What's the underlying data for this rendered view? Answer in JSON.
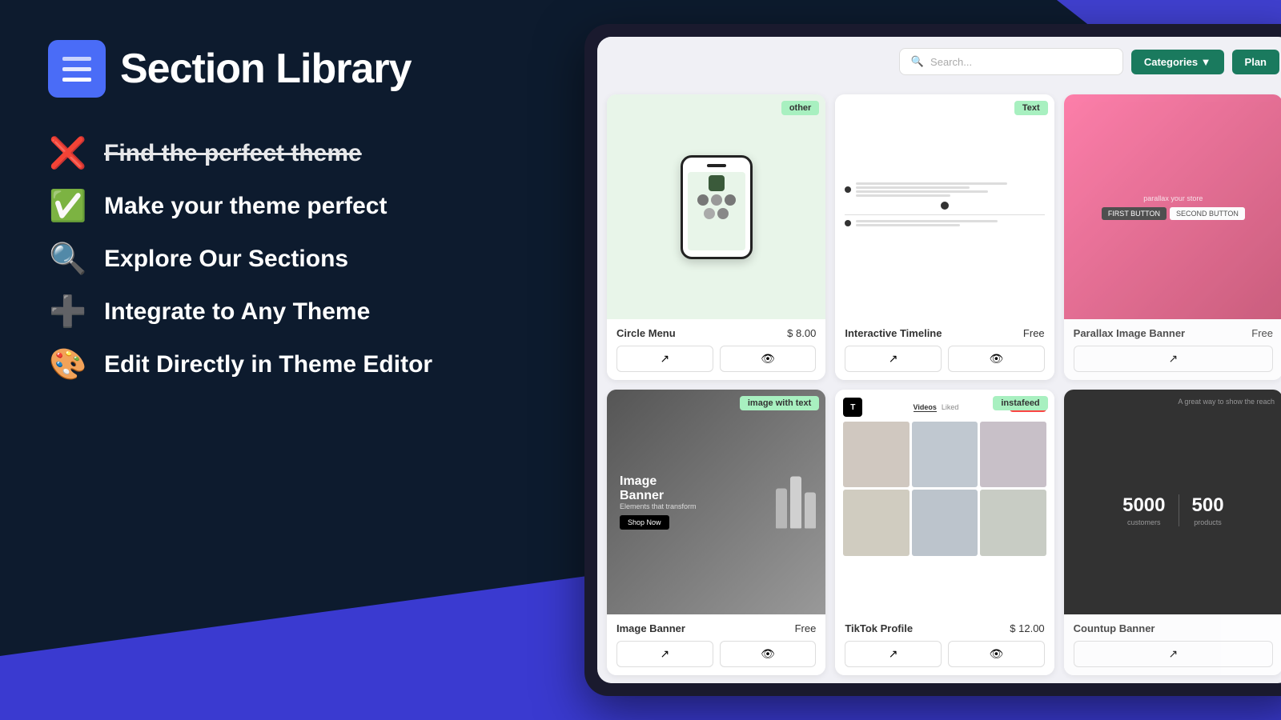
{
  "app": {
    "title": "Section Library"
  },
  "left": {
    "logo_text": "Section Library",
    "features": [
      {
        "icon": "❌",
        "text": "Find the perfect theme",
        "strikethrough": true
      },
      {
        "icon": "✅",
        "text": "Make your theme perfect",
        "strikethrough": false
      },
      {
        "icon": "🔍",
        "text": "Explore Our Sections",
        "strikethrough": false
      },
      {
        "icon": "➕",
        "text": "Integrate to Any Theme",
        "strikethrough": false
      },
      {
        "icon": "🎨",
        "text": "Edit Directly in Theme Editor",
        "strikethrough": false
      }
    ]
  },
  "app_ui": {
    "search_placeholder": "Search...",
    "categories_label": "Categories ▼",
    "plan_label": "Plan",
    "cards": [
      {
        "name": "Circle Menu",
        "price": "$ 8.00",
        "badge": "other",
        "badge_class": "badge-other",
        "type": "circle-menu"
      },
      {
        "name": "Interactive Timeline",
        "price": "Free",
        "badge": "Text",
        "badge_class": "badge-text",
        "type": "timeline"
      },
      {
        "name": "Parallax Image Banner",
        "price": "Free",
        "badge": null,
        "type": "parallax"
      },
      {
        "name": "Image Banner",
        "price": "Free",
        "badge": "image with text",
        "badge_class": "badge-image-with-text",
        "type": "image-banner"
      },
      {
        "name": "TikTok Profile",
        "price": "$ 12.00",
        "badge": "instafeed",
        "badge_class": "badge-instafeed",
        "type": "tiktok"
      },
      {
        "name": "Countup Banner",
        "price": "",
        "badge": null,
        "type": "countup"
      }
    ],
    "icons": {
      "search": "🔍",
      "external_link": "↗",
      "eye": "👁"
    }
  }
}
